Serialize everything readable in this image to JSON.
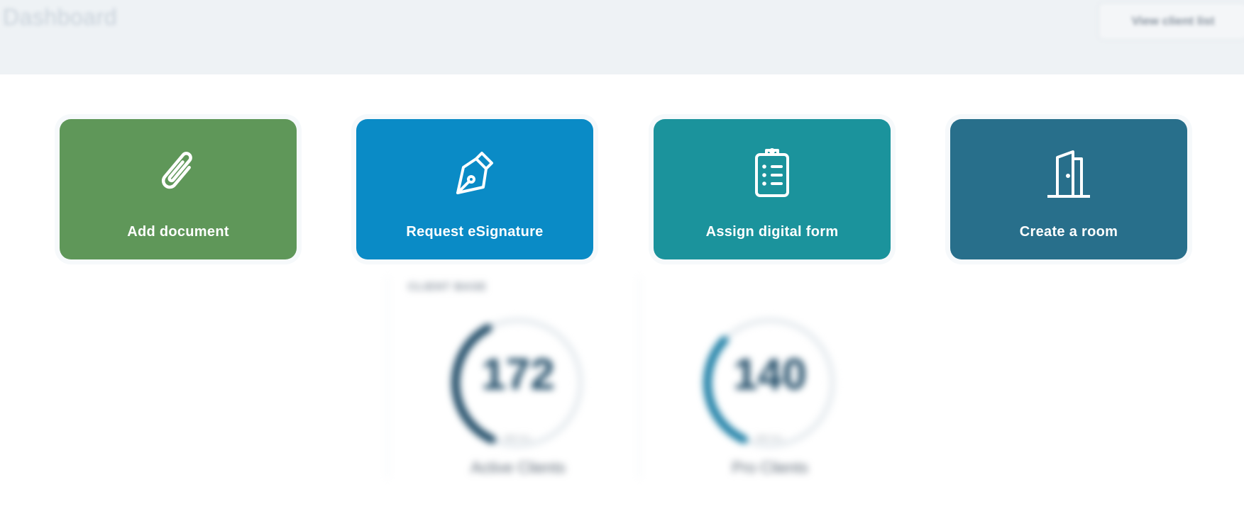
{
  "header": {
    "title": "Dashboard",
    "right_button_label": "View client list"
  },
  "actions": [
    {
      "label": "Add document",
      "icon": "paperclip-icon",
      "color": "#5f9759"
    },
    {
      "label": "Request eSignature",
      "icon": "pen-nib-icon",
      "color": "#0a8bc6"
    },
    {
      "label": "Assign digital form",
      "icon": "clipboard-list-icon",
      "color": "#1b939c"
    },
    {
      "label": "Create a room",
      "icon": "door-open-icon",
      "color": "#286f8b"
    }
  ],
  "client_base": {
    "section_label": "CLIENT BASE",
    "gauges": [
      {
        "value": "172",
        "sub": "SEE ALL",
        "caption": "Active Clients",
        "color": "#1f4b67",
        "fraction": 0.35
      },
      {
        "value": "140",
        "sub": "SEE ALL",
        "caption": "Pro Clients",
        "color": "#1d7fa6",
        "fraction": 0.3
      }
    ]
  }
}
